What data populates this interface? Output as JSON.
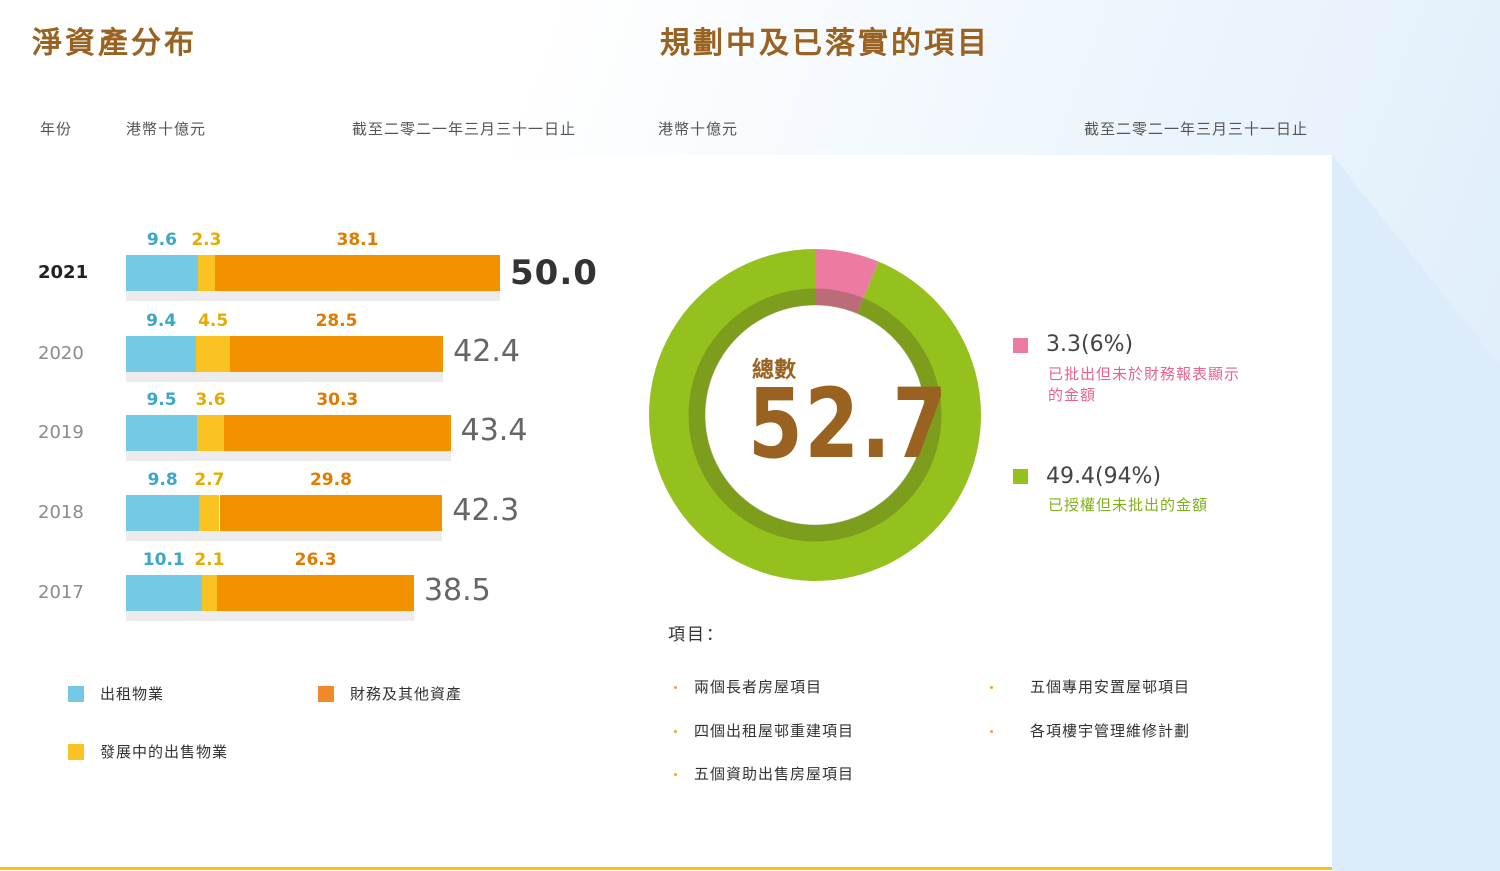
{
  "left_title": "淨資產分布",
  "right_title": "規劃中及已落實的項目",
  "headers": {
    "year": "年份",
    "unit_left": "港幣十億元",
    "date_left": "截至二零二一年三月三十一日止",
    "unit_right": "港幣十億元",
    "date_right": "截至二零二一年三月三十一日止"
  },
  "colors": {
    "rental": "#74c9e5",
    "sale": "#fbc321",
    "financial": "#f39200",
    "approved": "#ed7aa0",
    "authorised": "#95c11f",
    "brown": "#9a6221"
  },
  "legend": {
    "rental": "出租物業",
    "financial": "財務及其他資產",
    "sale": "發展中的出售物業"
  },
  "chart_data": [
    {
      "type": "bar",
      "orientation": "horizontal",
      "stacked": true,
      "title": "淨資產分布",
      "unit": "港幣十億元",
      "categories": [
        "2021",
        "2020",
        "2019",
        "2018",
        "2017"
      ],
      "series": [
        {
          "name": "出租物業",
          "values": [
            9.6,
            9.4,
            9.5,
            9.8,
            10.1
          ]
        },
        {
          "name": "發展中的出售物業",
          "values": [
            2.3,
            4.5,
            3.6,
            2.7,
            2.1
          ]
        },
        {
          "name": "財務及其他資產",
          "values": [
            38.1,
            28.5,
            30.3,
            29.8,
            26.3
          ]
        }
      ],
      "value_labels": [
        [
          "9.6",
          "2.3",
          "38.1"
        ],
        [
          "9.4",
          "4.5",
          "28.5"
        ],
        [
          "9.5",
          "3.6",
          "30.3"
        ],
        [
          "9.8",
          "2.7",
          "29.8"
        ],
        [
          "10.1",
          "2.1",
          "26.3"
        ]
      ],
      "totals": [
        50.0,
        42.4,
        43.4,
        42.3,
        38.5
      ],
      "total_labels": [
        "50.0",
        "42.4",
        "43.4",
        "42.3",
        "38.5"
      ],
      "legend_position": "bottom"
    },
    {
      "type": "pie",
      "donut": true,
      "title": "規劃中及已落實的項目",
      "unit": "港幣十億元",
      "center_label": "總數",
      "total": 52.7,
      "total_label": "52.7",
      "slices": [
        {
          "name": "已批出但未於財務報表顯示的金額",
          "value": 3.3,
          "percent": 6,
          "label": "3.3(6%)"
        },
        {
          "name": "已授權但未批出的金額",
          "value": 49.4,
          "percent": 94,
          "label": "49.4(94%)"
        }
      ],
      "legend_position": "right"
    }
  ],
  "donut_legend": [
    {
      "value_label": "3.3(6%)",
      "desc_line1": "已批出但未於財務報表顯示",
      "desc_line2": "的金額"
    },
    {
      "value_label": "49.4(94%)",
      "desc_line1": "已授權但未批出的金額",
      "desc_line2": ""
    }
  ],
  "projects": {
    "title": "項目：",
    "items": [
      "兩個長者房屋項目",
      "五個專用安置屋邨項目",
      "四個出租屋邨重建項目",
      "各項樓宇管理維修計劃",
      "五個資助出售房屋項目"
    ]
  }
}
